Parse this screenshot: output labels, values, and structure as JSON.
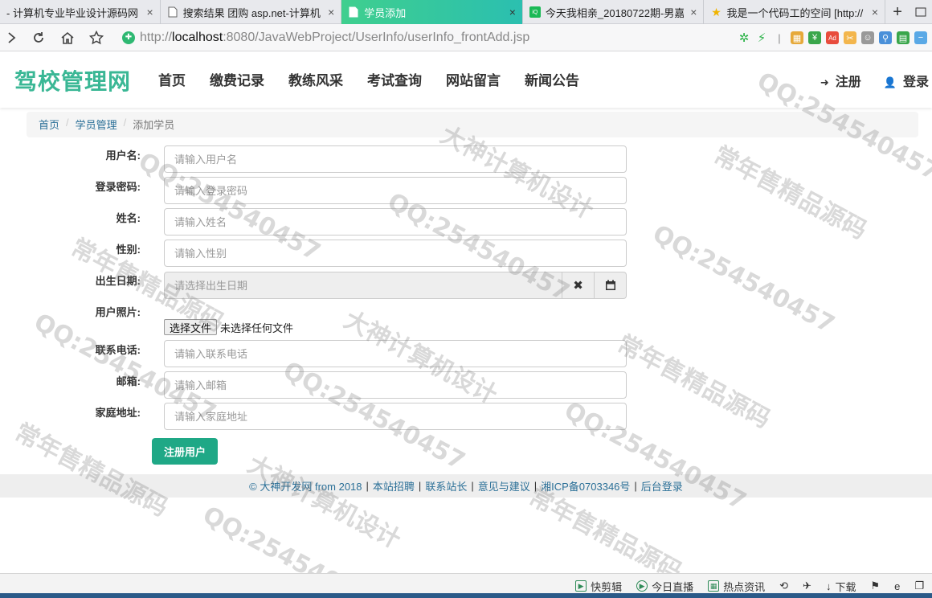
{
  "browser": {
    "tabs": [
      {
        "label": "- 计算机专业毕业设计源码网",
        "icon": "page-icon",
        "active": false
      },
      {
        "label": "搜索结果 团购 asp.net-计算机",
        "icon": "page-icon",
        "active": false
      },
      {
        "label": "学员添加",
        "icon": "page-icon",
        "active": true
      },
      {
        "label": "今天我相亲_20180722期-男嘉",
        "icon": "iqiyi-icon",
        "active": false
      },
      {
        "label": "我是一个代码工的空间 [http://",
        "icon": "star-icon",
        "active": false
      }
    ],
    "tab_close": "×",
    "new_tab": "+",
    "url_prefix": "http://",
    "url_host": "localhost",
    "url_rest": ":8080/JavaWebProject/UserInfo/userInfo_frontAdd.jsp"
  },
  "site": {
    "brand": "驾校管理网",
    "menu": [
      "首页",
      "缴费记录",
      "教练风采",
      "考试查询",
      "网站留言",
      "新闻公告"
    ],
    "register": "注册",
    "login": "登录"
  },
  "breadcrumb": {
    "home": "首页",
    "section": "学员管理",
    "current": "添加学员",
    "sep": "/"
  },
  "form": {
    "username": {
      "label": "用户名:",
      "placeholder": "请输入用户名"
    },
    "password": {
      "label": "登录密码:",
      "placeholder": "请输入登录密码"
    },
    "name": {
      "label": "姓名:",
      "placeholder": "请输入姓名"
    },
    "gender": {
      "label": "性别:",
      "placeholder": "请输入性别"
    },
    "birthday": {
      "label": "出生日期:",
      "placeholder": "请选择出生日期"
    },
    "photo": {
      "label": "用户照片:",
      "button": "选择文件",
      "status": "未选择任何文件"
    },
    "phone": {
      "label": "联系电话:",
      "placeholder": "请输入联系电话"
    },
    "email": {
      "label": "邮箱:",
      "placeholder": "请输入邮箱"
    },
    "address": {
      "label": "家庭地址:",
      "placeholder": "请输入家庭地址"
    },
    "submit": "注册用户"
  },
  "footer": {
    "copyright": "© 大神开发网 from 2018",
    "links": [
      "本站招聘",
      "联系站长",
      "意见与建议",
      "湘ICP备0703346号",
      "后台登录"
    ]
  },
  "statusbar": {
    "items": [
      "快剪辑",
      "今日直播",
      "热点资讯",
      "下载"
    ]
  },
  "watermark": {
    "texts": [
      "常年售精品源码",
      "QQ:254540457",
      "大神计算机设计"
    ]
  },
  "colors": {
    "brand": "#3ab795",
    "accent_tab": "#3fcf8e",
    "submit": "#1fa886",
    "link": "#2a6f97"
  }
}
